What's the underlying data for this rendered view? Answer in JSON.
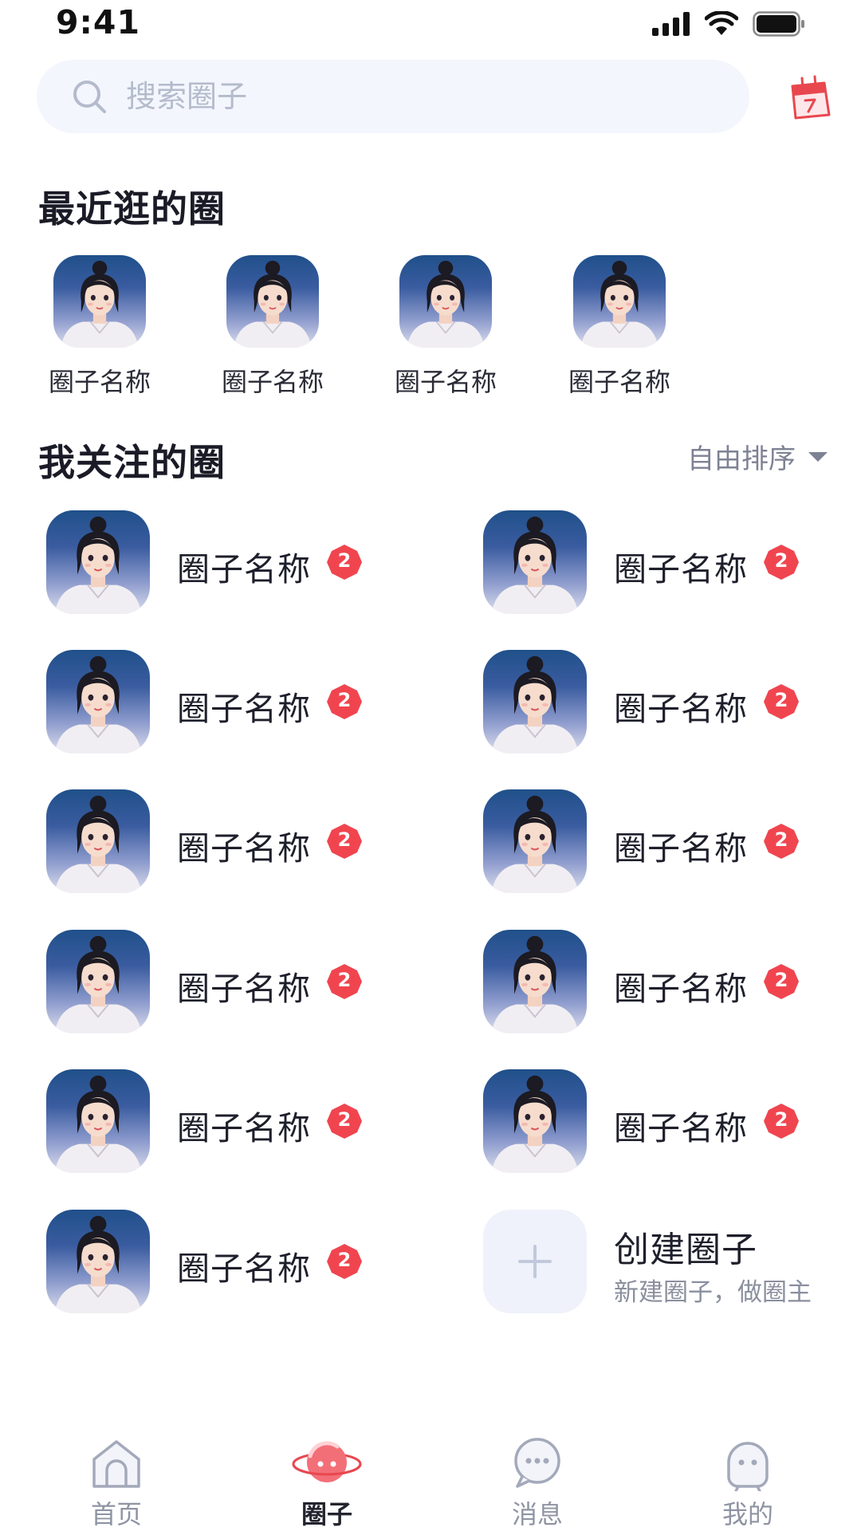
{
  "status_bar": {
    "time": "9:41"
  },
  "search": {
    "placeholder": "搜索圈子"
  },
  "recent": {
    "title": "最近逛的圈",
    "items": [
      {
        "name": "圈子名称"
      },
      {
        "name": "圈子名称"
      },
      {
        "name": "圈子名称"
      },
      {
        "name": "圈子名称"
      }
    ]
  },
  "followed": {
    "title": "我关注的圈",
    "sort_label": "自由排序",
    "items": [
      {
        "name": "圈子名称",
        "badge": "2"
      },
      {
        "name": "圈子名称",
        "badge": "2"
      },
      {
        "name": "圈子名称",
        "badge": "2"
      },
      {
        "name": "圈子名称",
        "badge": "2"
      },
      {
        "name": "圈子名称",
        "badge": "2"
      },
      {
        "name": "圈子名称",
        "badge": "2"
      },
      {
        "name": "圈子名称",
        "badge": "2"
      },
      {
        "name": "圈子名称",
        "badge": "2"
      },
      {
        "name": "圈子名称",
        "badge": "2"
      },
      {
        "name": "圈子名称",
        "badge": "2"
      },
      {
        "name": "圈子名称",
        "badge": "2"
      }
    ],
    "create": {
      "title": "创建圈子",
      "subtitle": "新建圈子，做圈主"
    }
  },
  "tab_bar": {
    "tabs": [
      {
        "label": "首页",
        "icon": "home-icon"
      },
      {
        "label": "圈子",
        "icon": "circle-planet-icon",
        "active": true
      },
      {
        "label": "消息",
        "icon": "message-icon"
      },
      {
        "label": "我的",
        "icon": "profile-icon"
      }
    ]
  },
  "colors": {
    "accent_red": "#f0454f",
    "search_bg": "#f3f6fc",
    "placeholder": "#b4bbcc",
    "tab_inactive": "#8f94a3",
    "create_bg": "#eff2fb"
  }
}
